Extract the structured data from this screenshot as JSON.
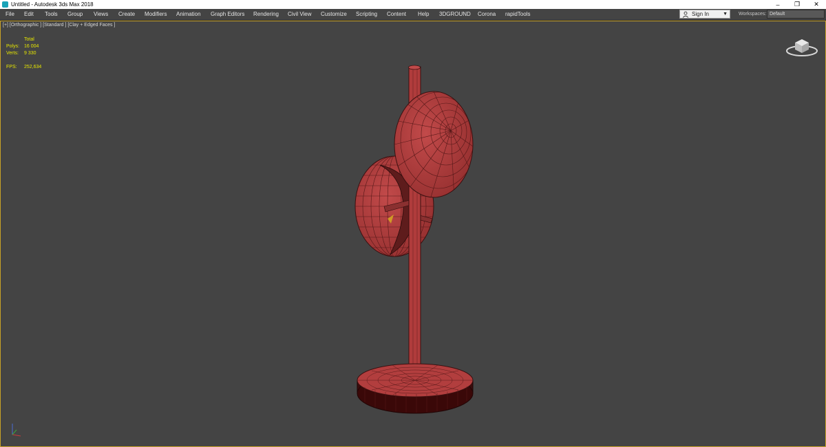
{
  "titlebar": {
    "title": "Untitled - Autodesk 3ds Max 2018",
    "minimize_glyph": "–",
    "restore_glyph": "❐",
    "close_glyph": "✕"
  },
  "menubar": {
    "items": [
      "File",
      "Edit",
      "Tools",
      "Group",
      "Views",
      "Create",
      "Modifiers",
      "Animation",
      "Graph Editors",
      "Rendering",
      "Civil View",
      "Customize",
      "Scripting",
      "Content",
      "Help",
      "3DGROUND",
      "Corona",
      "rapidTools"
    ]
  },
  "account": {
    "signin_label": "Sign In",
    "workspaces_label": "Workspaces:",
    "workspace_value": "Default"
  },
  "viewport": {
    "label": "[+] [Orthographic ] [Standard ] [Clay + Edged Faces ]",
    "stats": {
      "total_label": "Total",
      "polys_label": "Polys:",
      "polys_value": "16 004",
      "verts_label": "Verts:",
      "verts_value": "9 330",
      "fps_label": "FPS:",
      "fps_value": "252,634"
    }
  },
  "colors": {
    "viewport_bg": "#444444",
    "model_red": "#b03c3c",
    "stats_yellow": "#e6e600",
    "active_border": "#c9a227"
  }
}
